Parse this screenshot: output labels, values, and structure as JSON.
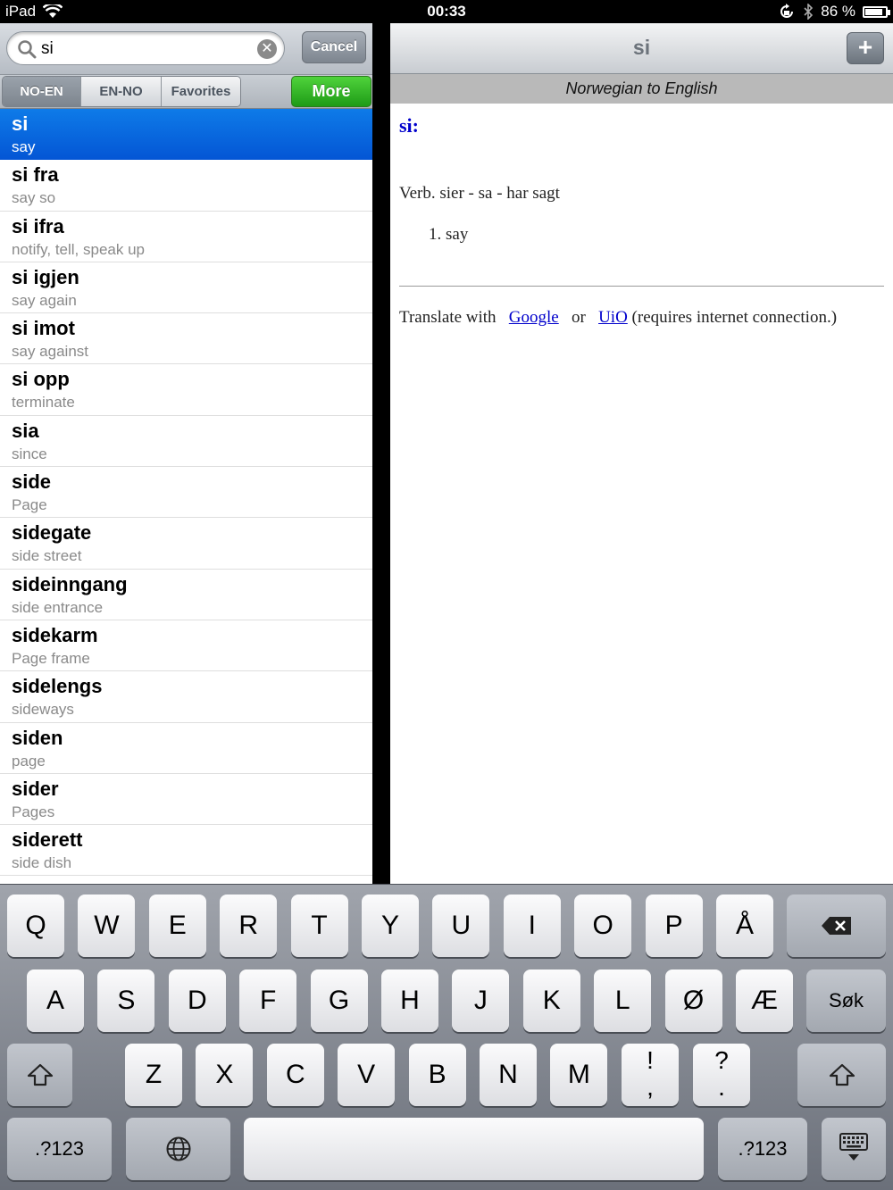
{
  "status": {
    "device": "iPad",
    "time": "00:33",
    "battery": "86 %",
    "battery_level": 0.86
  },
  "search": {
    "value": "si",
    "cancel_label": "Cancel"
  },
  "segments": [
    {
      "label": "NO-EN",
      "active": true
    },
    {
      "label": "EN-NO",
      "active": false
    },
    {
      "label": "Favorites",
      "active": false
    }
  ],
  "more_label": "More",
  "list": [
    {
      "word": "si",
      "translation": "say",
      "selected": true
    },
    {
      "word": "si fra",
      "translation": "say so"
    },
    {
      "word": "si ifra",
      "translation": "notify, tell, speak up"
    },
    {
      "word": "si igjen",
      "translation": "say again"
    },
    {
      "word": "si imot",
      "translation": "say against"
    },
    {
      "word": "si opp",
      "translation": "terminate"
    },
    {
      "word": "sia",
      "translation": "since"
    },
    {
      "word": "side",
      "translation": "Page"
    },
    {
      "word": "sidegate",
      "translation": "side street"
    },
    {
      "word": "sideinngang",
      "translation": "side entrance"
    },
    {
      "word": "sidekarm",
      "translation": "Page frame"
    },
    {
      "word": "sidelengs",
      "translation": "sideways"
    },
    {
      "word": "siden",
      "translation": "page"
    },
    {
      "word": "sider",
      "translation": "Pages"
    },
    {
      "word": "siderett",
      "translation": "side dish"
    }
  ],
  "detail": {
    "title": "si",
    "add_label": "+",
    "subheader": "Norwegian to English",
    "headword": "si:",
    "grammar": "Verb. sier - sa - har sagt",
    "senses": [
      "say"
    ],
    "translate": {
      "prefix": "Translate with",
      "link1": "Google",
      "or": "or",
      "link2": "UiO",
      "suffix": "(requires internet connection.)"
    }
  },
  "keyboard": {
    "row1": [
      "Q",
      "W",
      "E",
      "R",
      "T",
      "Y",
      "U",
      "I",
      "O",
      "P",
      "Å"
    ],
    "row2": [
      "A",
      "S",
      "D",
      "F",
      "G",
      "H",
      "J",
      "K",
      "L",
      "Ø",
      "Æ"
    ],
    "row3": [
      "Z",
      "X",
      "C",
      "V",
      "B",
      "N",
      "M"
    ],
    "punct1": [
      "!",
      ","
    ],
    "punct2": [
      "?",
      "."
    ],
    "search_label": "Søk",
    "numbers_label": ".?123"
  }
}
